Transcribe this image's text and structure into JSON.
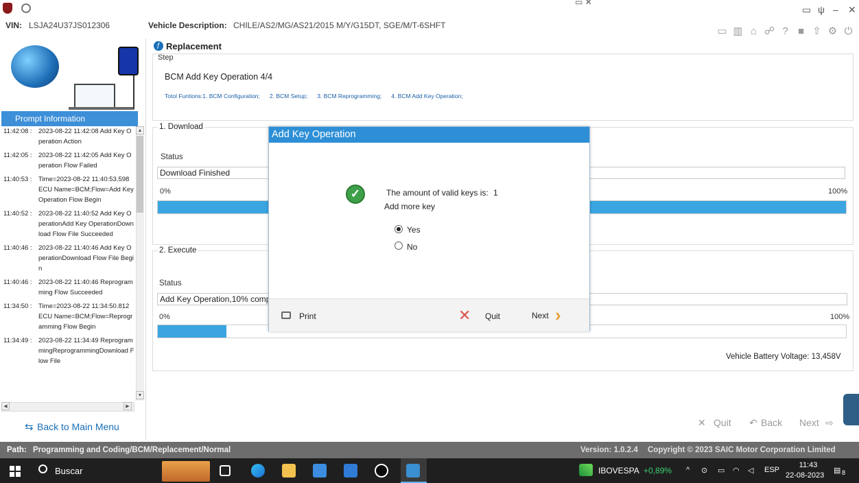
{
  "vehicle": {
    "vin_label": "VIN:",
    "vin": "LSJA24U37JS012306",
    "desc_label": "Vehicle Description:",
    "desc": "CHILE/AS2/MG/AS21/2015 M/Y/G15DT, SGE/M/T-6SHFT"
  },
  "top_icons": [
    "folder-icon",
    "chart-icon",
    "home-icon",
    "network-icon",
    "help-icon",
    "stop-icon",
    "export-icon",
    "settings-icon",
    "power-icon"
  ],
  "left": {
    "prompt_title": "Prompt Information",
    "logs": [
      {
        "time": "11:42:08 :",
        "msg": "2023-08-22 11:42:08 Add Key Operation Action"
      },
      {
        "time": "11:42:05 :",
        "msg": "2023-08-22 11:42:05 Add Key Operation Flow  Failed"
      },
      {
        "time": "11:40:53 :",
        "msg": "Time=2023-08-22 11:40:53.598 ECU Name=BCM;Flow=Add Key Operation Flow Begin"
      },
      {
        "time": "11:40:52 :",
        "msg": "2023-08-22 11:40:52 Add Key OperationAdd Key OperationDownload Flow File Succeeded"
      },
      {
        "time": "11:40:46 :",
        "msg": "2023-08-22 11:40:46 Add Key OperationDownload Flow File Begin"
      },
      {
        "time": "11:40:46 :",
        "msg": "2023-08-22 11:40:46 Reprogramming Flow Succeeded"
      },
      {
        "time": "11:34:50 :",
        "msg": "Time=2023-08-22 11:34:50.812 ECU Name=BCM;Flow=Reprogramming Flow Begin"
      },
      {
        "time": "11:34:49 :",
        "msg": "2023-08-22 11:34:49 ReprogrammingReprogrammingDownload Flow File"
      }
    ],
    "back_label": "Back to Main Menu"
  },
  "main": {
    "title": "Replacement",
    "step_label": "Step",
    "step_title": "BCM Add Key Operation 4/4",
    "functions": [
      "Totol Funtions:1. BCM Configuration;",
      "2. BCM Setup;",
      "3. BCM Reprogramming;",
      "4. BCM Add Key Operation;"
    ],
    "download": {
      "label": "1. Download",
      "status_label": "Status",
      "status": "Download Finished",
      "start": "0%",
      "end": "100%",
      "progress": 1.0
    },
    "execute": {
      "label": "2. Execute",
      "status_label": "Status",
      "status": "Add Key Operation,10% complete",
      "start": "0%",
      "end": "100%",
      "progress": 0.1
    },
    "battery": "Vehicle Battery Voltage: 13,458V"
  },
  "nav": {
    "quit": "Quit",
    "back": "Back",
    "next": "Next"
  },
  "dialog": {
    "title": "Add Key Operation",
    "message": "The amount of valid keys is:",
    "count": "1",
    "question": "Add more key",
    "options": [
      {
        "label": "Yes",
        "selected": true
      },
      {
        "label": "No",
        "selected": false
      }
    ],
    "print": "Print",
    "quit": "Quit",
    "next": "Next"
  },
  "pathbar": {
    "label": "Path:",
    "value": "Programming and Coding/BCM/Replacement/Normal",
    "version": "Version:  1.0.2.4",
    "copyright": "Copyright © 2023 SAIC Motor Corporation Limited"
  },
  "taskbar": {
    "search": "Buscar",
    "ticker": "IBOVESPA",
    "ticker_change": "+0,89%",
    "lang": "ESP",
    "time": "11:43",
    "date": "22-08-2023",
    "notif": "8"
  },
  "colors": {
    "accent": "#2e8fd6",
    "progress": "#3aa5e0",
    "pathbar": "#6d6d6d"
  }
}
